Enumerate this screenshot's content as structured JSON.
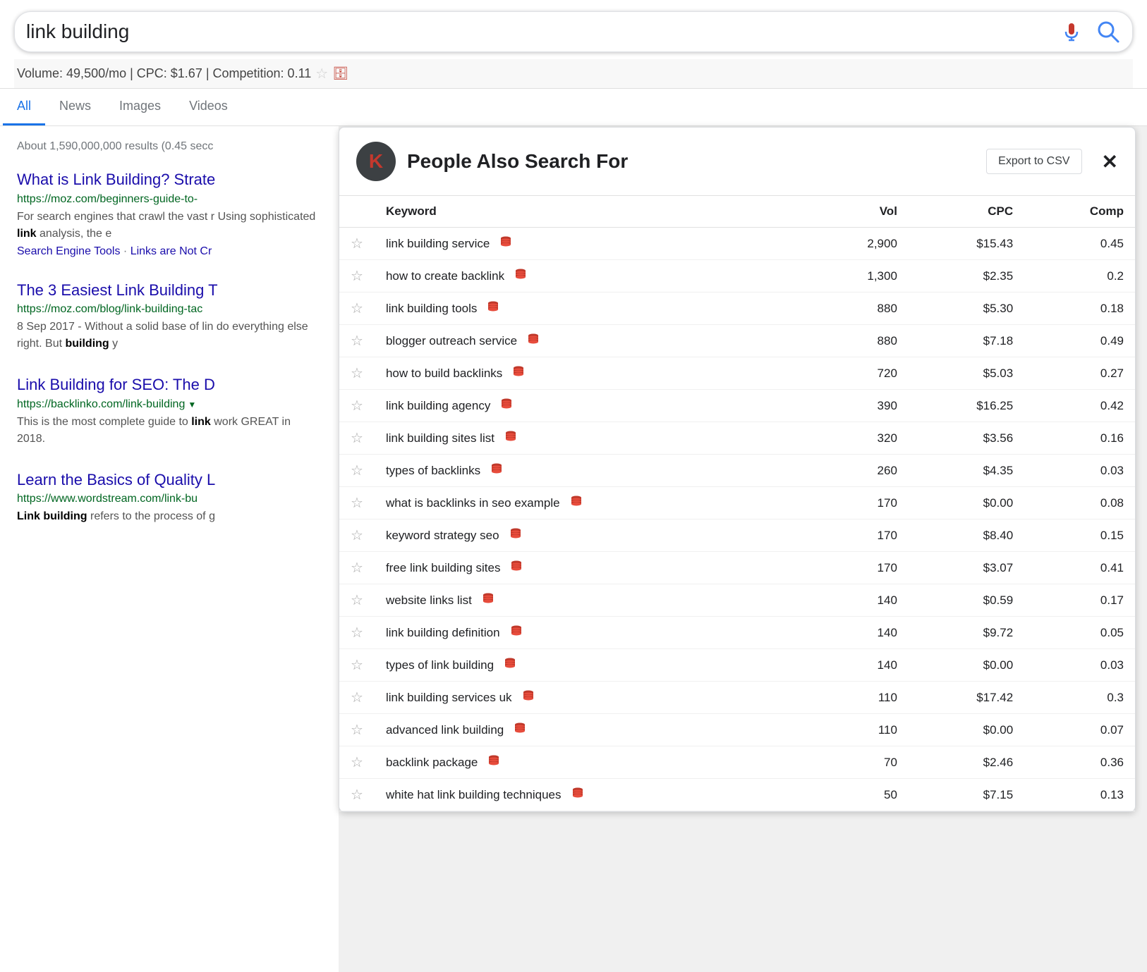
{
  "search": {
    "query": "link building",
    "volume_line": "Volume: 49,500/mo | CPC: $1.67 | Competition: 0.11"
  },
  "nav": {
    "tabs": [
      "All",
      "News",
      "Images",
      "Videos"
    ],
    "active_tab": "All"
  },
  "results": {
    "count_text": "About 1,590,000,000 results (0.45 secc",
    "items": [
      {
        "title": "What is Link Building? Strate",
        "url": "https://moz.com/beginners-guide-to-",
        "snippet": "For search engines that crawl the vast r Using sophisticated link analysis, the e",
        "links": "Search Engine Tools · Links are Not Cr"
      },
      {
        "title": "The 3 Easiest Link Building T",
        "url": "https://moz.com/blog/link-building-tac",
        "snippet": "8 Sep 2017 - Without a solid base of lin do everything else right. But building y",
        "links": ""
      },
      {
        "title": "Link Building for SEO: The D",
        "url": "https://backlinko.com/link-building",
        "snippet": "This is the most complete guide to link work GREAT in 2018.",
        "links": ""
      },
      {
        "title": "Learn the Basics of Quality L",
        "url": "https://www.wordstream.com/link-bu",
        "snippet": "Link building refers to the process of g",
        "links": ""
      }
    ]
  },
  "pasf": {
    "title": "People Also Search For",
    "export_label": "Export to CSV",
    "close_label": "✕",
    "avatar_letter": "K",
    "columns": {
      "keyword": "Keyword",
      "vol": "Vol",
      "cpc": "CPC",
      "comp": "Comp"
    },
    "rows": [
      {
        "keyword": "link building service",
        "vol": "2,900",
        "cpc": "$15.43",
        "comp": "0.45"
      },
      {
        "keyword": "how to create backlink",
        "vol": "1,300",
        "cpc": "$2.35",
        "comp": "0.2"
      },
      {
        "keyword": "link building tools",
        "vol": "880",
        "cpc": "$5.30",
        "comp": "0.18"
      },
      {
        "keyword": "blogger outreach service",
        "vol": "880",
        "cpc": "$7.18",
        "comp": "0.49"
      },
      {
        "keyword": "how to build backlinks",
        "vol": "720",
        "cpc": "$5.03",
        "comp": "0.27"
      },
      {
        "keyword": "link building agency",
        "vol": "390",
        "cpc": "$16.25",
        "comp": "0.42"
      },
      {
        "keyword": "link building sites list",
        "vol": "320",
        "cpc": "$3.56",
        "comp": "0.16"
      },
      {
        "keyword": "types of backlinks",
        "vol": "260",
        "cpc": "$4.35",
        "comp": "0.03"
      },
      {
        "keyword": "what is backlinks in seo example",
        "vol": "170",
        "cpc": "$0.00",
        "comp": "0.08"
      },
      {
        "keyword": "keyword strategy seo",
        "vol": "170",
        "cpc": "$8.40",
        "comp": "0.15"
      },
      {
        "keyword": "free link building sites",
        "vol": "170",
        "cpc": "$3.07",
        "comp": "0.41"
      },
      {
        "keyword": "website links list",
        "vol": "140",
        "cpc": "$0.59",
        "comp": "0.17"
      },
      {
        "keyword": "link building definition",
        "vol": "140",
        "cpc": "$9.72",
        "comp": "0.05"
      },
      {
        "keyword": "types of link building",
        "vol": "140",
        "cpc": "$0.00",
        "comp": "0.03"
      },
      {
        "keyword": "link building services uk",
        "vol": "110",
        "cpc": "$17.42",
        "comp": "0.3"
      },
      {
        "keyword": "advanced link building",
        "vol": "110",
        "cpc": "$0.00",
        "comp": "0.07"
      },
      {
        "keyword": "backlink package",
        "vol": "70",
        "cpc": "$2.46",
        "comp": "0.36"
      },
      {
        "keyword": "white hat link building techniques",
        "vol": "50",
        "cpc": "$7.15",
        "comp": "0.13"
      }
    ]
  }
}
